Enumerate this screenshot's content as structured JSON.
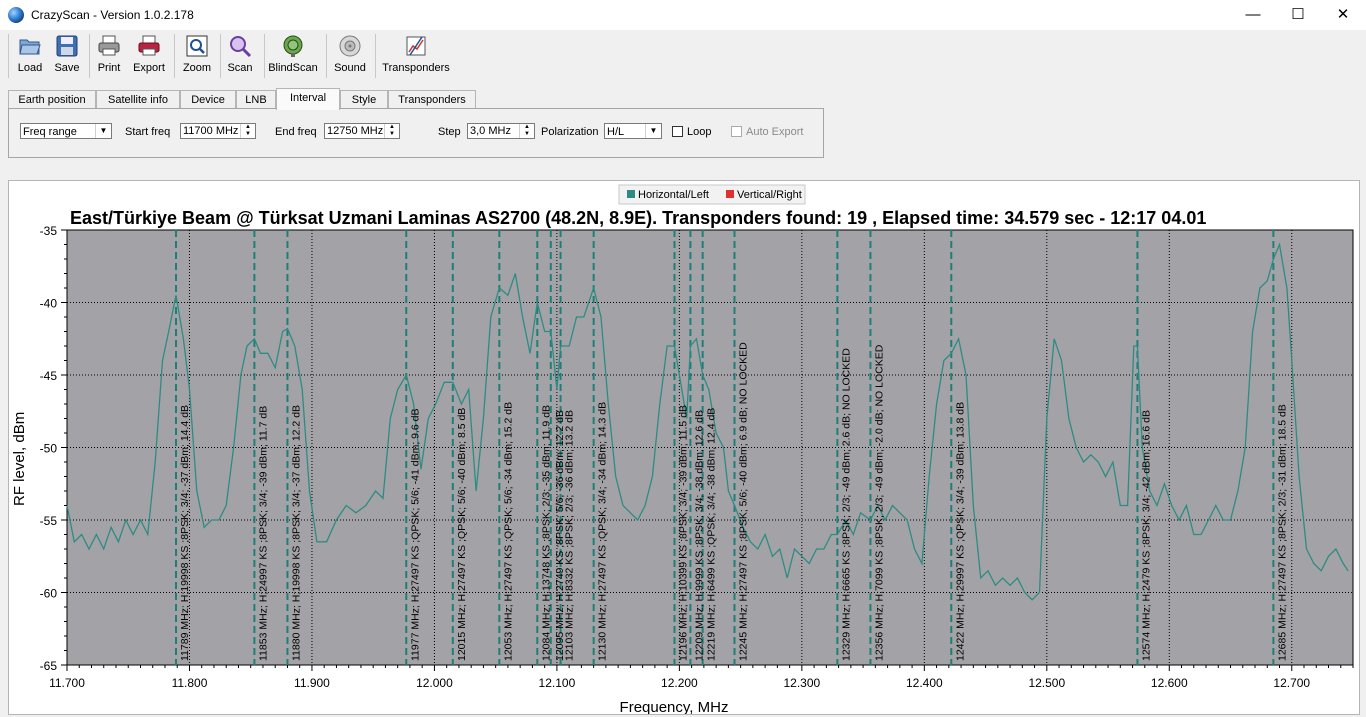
{
  "window": {
    "title": "CrazyScan - Version 1.0.2.178",
    "minimize": "—",
    "maximize": "☐",
    "close": "✕"
  },
  "toolbar": {
    "load": "Load",
    "save": "Save",
    "print": "Print",
    "export": "Export",
    "zoom": "Zoom",
    "scan": "Scan",
    "blindscan": "BlindScan",
    "sound": "Sound",
    "transponders": "Transponders"
  },
  "tabs": [
    "Earth position",
    "Satellite info",
    "Device",
    "LNB",
    "Interval",
    "Style",
    "Transponders"
  ],
  "active_tab": "Interval",
  "interval": {
    "mode": "Freq range",
    "start_label": "Start freq",
    "start_value": "11700 MHz",
    "end_label": "End freq",
    "end_value": "12750 MHz",
    "step_label": "Step",
    "step_value": "3,0 MHz",
    "polarization_label": "Polarization",
    "polarization_value": "H/L",
    "loop_label": "Loop",
    "loop_checked": false,
    "auto_export_label": "Auto Export",
    "auto_export_checked": false
  },
  "colors": {
    "trace": "#2e8b84",
    "marker": "#1e7f78",
    "plot_bg": "#a3a3a7",
    "vertical_right": "#e03030"
  },
  "chart_data": {
    "type": "line",
    "title": "East/Türkiye Beam @ Türksat Uzmani Laminas AS2700 (48.2N, 8.9E). Transponders found: 19 , Elapsed time: 34.579 sec - 12:17 04.01",
    "xlabel": "Frequency, MHz",
    "ylabel": "RF level, dBm",
    "xlim": [
      11700,
      12750
    ],
    "ylim": [
      -65,
      -35
    ],
    "xticks": [
      "11.700",
      "11.800",
      "11.900",
      "12.000",
      "12.100",
      "12.200",
      "12.300",
      "12.400",
      "12.500",
      "12.600",
      "12.700"
    ],
    "yticks": [
      "-35",
      "-40",
      "-45",
      "-50",
      "-55",
      "-60",
      "-65"
    ],
    "legend_position": "top",
    "series": [
      {
        "name": "Horizontal/Left",
        "points": [
          [
            11700,
            -54
          ],
          [
            11706,
            -56.5
          ],
          [
            11712,
            -56
          ],
          [
            11718,
            -57
          ],
          [
            11724,
            -56
          ],
          [
            11730,
            -57
          ],
          [
            11736,
            -55.5
          ],
          [
            11742,
            -56.5
          ],
          [
            11748,
            -55
          ],
          [
            11754,
            -56
          ],
          [
            11760,
            -55
          ],
          [
            11766,
            -56
          ],
          [
            11772,
            -51
          ],
          [
            11778,
            -44
          ],
          [
            11783,
            -42
          ],
          [
            11789,
            -39.5
          ],
          [
            11795,
            -42.5
          ],
          [
            11800,
            -46
          ],
          [
            11806,
            -53
          ],
          [
            11812,
            -55.5
          ],
          [
            11818,
            -55
          ],
          [
            11824,
            -55
          ],
          [
            11830,
            -54
          ],
          [
            11836,
            -50
          ],
          [
            11842,
            -45
          ],
          [
            11847,
            -43
          ],
          [
            11853,
            -42.5
          ],
          [
            11858,
            -43.5
          ],
          [
            11864,
            -43.5
          ],
          [
            11870,
            -44.5
          ],
          [
            11876,
            -42
          ],
          [
            11880,
            -41.8
          ],
          [
            11886,
            -43
          ],
          [
            11892,
            -46
          ],
          [
            11898,
            -53
          ],
          [
            11904,
            -56.5
          ],
          [
            11912,
            -56.5
          ],
          [
            11920,
            -55
          ],
          [
            11928,
            -54
          ],
          [
            11936,
            -54.5
          ],
          [
            11944,
            -54
          ],
          [
            11952,
            -53
          ],
          [
            11958,
            -53.5
          ],
          [
            11964,
            -48
          ],
          [
            11970,
            -46
          ],
          [
            11977,
            -45
          ],
          [
            11983,
            -47
          ],
          [
            11989,
            -51.5
          ],
          [
            11995,
            -48
          ],
          [
            12001,
            -47
          ],
          [
            12008,
            -45.5
          ],
          [
            12015,
            -45.5
          ],
          [
            12022,
            -47
          ],
          [
            12028,
            -46
          ],
          [
            12034,
            -53
          ],
          [
            12040,
            -48
          ],
          [
            12046,
            -41
          ],
          [
            12053,
            -39
          ],
          [
            12060,
            -39.5
          ],
          [
            12066,
            -38
          ],
          [
            12072,
            -41
          ],
          [
            12078,
            -43.5
          ],
          [
            12084,
            -40
          ],
          [
            12090,
            -42
          ],
          [
            12095,
            -42
          ],
          [
            12100,
            -46
          ],
          [
            12103,
            -43
          ],
          [
            12110,
            -43
          ],
          [
            12116,
            -41
          ],
          [
            12122,
            -41
          ],
          [
            12130,
            -39
          ],
          [
            12136,
            -41
          ],
          [
            12142,
            -47
          ],
          [
            12148,
            -52
          ],
          [
            12154,
            -54
          ],
          [
            12160,
            -54.5
          ],
          [
            12166,
            -55
          ],
          [
            12172,
            -54
          ],
          [
            12178,
            -52
          ],
          [
            12184,
            -47
          ],
          [
            12190,
            -43
          ],
          [
            12196,
            -43
          ],
          [
            12202,
            -46
          ],
          [
            12206,
            -48
          ],
          [
            12209,
            -43
          ],
          [
            12214,
            -42.5
          ],
          [
            12219,
            -45
          ],
          [
            12224,
            -46
          ],
          [
            12230,
            -49
          ],
          [
            12236,
            -50
          ],
          [
            12240,
            -53
          ],
          [
            12245,
            -54
          ],
          [
            12252,
            -55.5
          ],
          [
            12258,
            -56.5
          ],
          [
            12264,
            -57
          ],
          [
            12270,
            -56
          ],
          [
            12276,
            -57.5
          ],
          [
            12282,
            -57
          ],
          [
            12288,
            -59
          ],
          [
            12294,
            -57
          ],
          [
            12300,
            -57.5
          ],
          [
            12306,
            -58
          ],
          [
            12312,
            -57
          ],
          [
            12318,
            -57
          ],
          [
            12324,
            -56
          ],
          [
            12329,
            -56
          ],
          [
            12336,
            -55
          ],
          [
            12342,
            -56
          ],
          [
            12348,
            -54.5
          ],
          [
            12356,
            -55
          ],
          [
            12362,
            -54
          ],
          [
            12368,
            -55
          ],
          [
            12374,
            -54
          ],
          [
            12380,
            -54.5
          ],
          [
            12386,
            -55
          ],
          [
            12392,
            -57
          ],
          [
            12398,
            -58
          ],
          [
            12404,
            -52
          ],
          [
            12410,
            -47
          ],
          [
            12416,
            -44
          ],
          [
            12422,
            -43.5
          ],
          [
            12428,
            -42.5
          ],
          [
            12434,
            -45
          ],
          [
            12440,
            -54
          ],
          [
            12446,
            -59
          ],
          [
            12452,
            -58.5
          ],
          [
            12458,
            -59.5
          ],
          [
            12464,
            -59
          ],
          [
            12470,
            -59.5
          ],
          [
            12476,
            -59
          ],
          [
            12482,
            -60
          ],
          [
            12488,
            -60.5
          ],
          [
            12494,
            -60
          ],
          [
            12500,
            -48
          ],
          [
            12506,
            -42.5
          ],
          [
            12512,
            -44
          ],
          [
            12518,
            -48
          ],
          [
            12524,
            -50
          ],
          [
            12530,
            -51
          ],
          [
            12536,
            -50.5
          ],
          [
            12542,
            -51
          ],
          [
            12548,
            -52
          ],
          [
            12554,
            -51
          ],
          [
            12560,
            -54
          ],
          [
            12566,
            -54
          ],
          [
            12571,
            -43
          ],
          [
            12574,
            -43
          ],
          [
            12578,
            -50
          ],
          [
            12584,
            -53
          ],
          [
            12590,
            -54
          ],
          [
            12596,
            -52.5
          ],
          [
            12602,
            -54
          ],
          [
            12608,
            -55
          ],
          [
            12614,
            -54
          ],
          [
            12620,
            -56
          ],
          [
            12626,
            -56
          ],
          [
            12632,
            -55
          ],
          [
            12638,
            -54
          ],
          [
            12644,
            -55
          ],
          [
            12650,
            -55
          ],
          [
            12656,
            -53
          ],
          [
            12662,
            -50
          ],
          [
            12668,
            -42
          ],
          [
            12674,
            -39
          ],
          [
            12680,
            -38.5
          ],
          [
            12685,
            -37
          ],
          [
            12690,
            -36
          ],
          [
            12696,
            -39
          ],
          [
            12700,
            -44
          ],
          [
            12706,
            -52
          ],
          [
            12712,
            -57
          ],
          [
            12718,
            -58
          ],
          [
            12724,
            -58.5
          ],
          [
            12730,
            -57.5
          ],
          [
            12736,
            -57
          ],
          [
            12742,
            -58
          ],
          [
            12746,
            -58.5
          ]
        ]
      }
    ],
    "legend": [
      {
        "name": "Horizontal/Left",
        "color": "#2e8b84"
      },
      {
        "name": "Vertical/Right",
        "color": "#e03030"
      }
    ],
    "transponders": [
      {
        "freq": 11789,
        "label": "11789 MHz; H;19998 KS ;8PSK; 3/4; -37 dBm; 14.4 dB"
      },
      {
        "freq": 11853,
        "label": "11853 MHz; H;24997 KS ;8PSK; 3/4; -39 dBm; 11.7 dB"
      },
      {
        "freq": 11880,
        "label": "11880 MHz; H;19998 KS ;8PSK; 3/4; -37 dBm; 12.2 dB"
      },
      {
        "freq": 11977,
        "label": "11977 MHz; H;27497 KS ;QPSK; 5/6; -41 dBm; 9.6 dB"
      },
      {
        "freq": 12015,
        "label": "12015 MHz; H;27497 KS ;QPSK; 5/6; -40 dBm; 8.5 dB"
      },
      {
        "freq": 12053,
        "label": "12053 MHz; H;27497 KS ;QPSK; 5/6; -34 dBm; 15.2 dB"
      },
      {
        "freq": 12084,
        "label": "12084 MHz; H;13748 KS ;8PSK; 2/3; -35 dBm; 11.9 dB"
      },
      {
        "freq": 12095,
        "label": "12095 MHz; H;2749 KS ;8PSK; 5/6; -36 dBm; 12.2 dB"
      },
      {
        "freq": 12103,
        "label": "12103 MHz; H;8332 KS ;8PSK; 2/3; -36 dBm; 13.2 dB"
      },
      {
        "freq": 12130,
        "label": "12130 MHz; H;27497 KS ;QPSK; 3/4; -34 dBm; 14.3 dB"
      },
      {
        "freq": 12196,
        "label": "12196 MHz; H;10399 KS ;8PSK; 3/4; -39 dBm; 11.5 dB"
      },
      {
        "freq": 12209,
        "label": "12209 MHz; H;9999 KS ;8PSK; 3/4; -38 dBm; 12.6 dB"
      },
      {
        "freq": 12219,
        "label": "12219 MHz; H;6499 KS ;QPSK; 3/4; -38 dBm; 12.4 dB"
      },
      {
        "freq": 12245,
        "label": "12245 MHz; H;27497 KS ;8PSK; 5/6; -40 dBm; 6.9 dB; NO LOCKED"
      },
      {
        "freq": 12329,
        "label": "12329 MHz; H;6665 KS ;8PSK; 2/3; -49 dBm; 2.6 dB; NO LOCKED"
      },
      {
        "freq": 12356,
        "label": "12356 MHz; H;7099 KS ;8PSK; 2/3; -49 dBm; -2.0 dB; NO LOCKED"
      },
      {
        "freq": 12422,
        "label": "12422 MHz; H;29997 KS ;QPSK; 3/4; -39 dBm; 13.8 dB"
      },
      {
        "freq": 12574,
        "label": "12574 MHz; H;2479 KS ;8PSK; 3/4; -42 dBm; 16.6 dB"
      },
      {
        "freq": 12685,
        "label": "12685 MHz; H;27497 KS ;8PSK; 2/3; -31 dBm; 18.5 dB"
      }
    ]
  }
}
